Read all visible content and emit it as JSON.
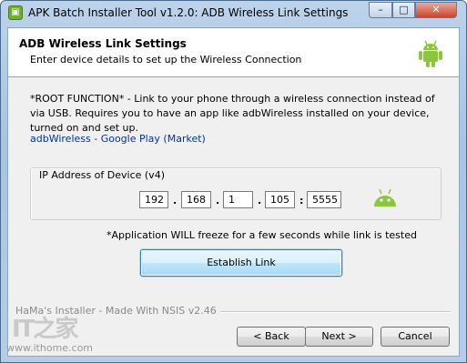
{
  "window": {
    "title": "APK Batch Installer Tool v1.2.0: ADB Wireless Link Settings",
    "minimize_glyph": "–",
    "maximize_glyph": "□",
    "close_glyph": "✕"
  },
  "header": {
    "title": "ADB Wireless Link Settings",
    "subtitle": "Enter device details to set up the Wireless Connection"
  },
  "body": {
    "description": "*ROOT FUNCTION* - Link to your phone through a wireless connection instead of via USB. Requires you to have an app like adbWireless installed on your device, turned on and set up.",
    "store_link": "adbWireless - Google Play (Market)"
  },
  "ip_group": {
    "label": "IP Address of Device (v4)",
    "octet1": "192",
    "octet2": "168",
    "octet3": "1",
    "octet4": "105",
    "port": "5555",
    "dot": ".",
    "colon": ":"
  },
  "note": "*Application WILL freeze for a few seconds while link is tested",
  "establish_label": "Establish Link",
  "footer": {
    "brand": "HaMa's Installer - Made With NSIS v2.46",
    "back_label": "< Back",
    "next_label": "Next >",
    "cancel_label": "Cancel"
  },
  "watermark": {
    "logo": "IT之家",
    "url": "www.ithome.com"
  },
  "colors": {
    "android_green": "#8cc63f",
    "link_blue": "#0033aa"
  }
}
